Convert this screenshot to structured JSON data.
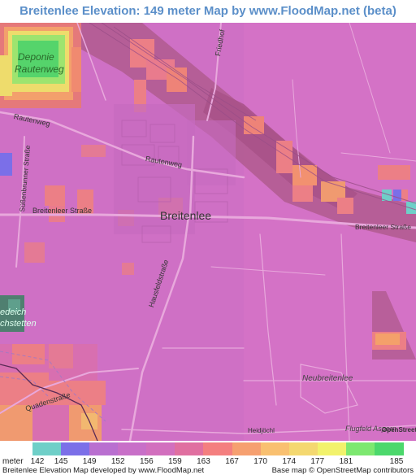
{
  "title": "Breitenlee Elevation: 149 meter Map by www.FloodMap.net (beta)",
  "map": {
    "labels": {
      "deponie": "Deponie",
      "rautenweg_deponie": "Rautenweg",
      "rautenweg_road1": "Rautenweg",
      "rautenweg_road2": "Rautenweg",
      "friedhof": "Friedhof",
      "breitenleer_strasse_w": "Breitenleer Straße",
      "breitenleer_strasse_e": "Breitenleer Straße",
      "breitenlee": "Breitenlee",
      "hausfeldstrasse": "Hausfeldstraße",
      "suessenbrunner": "Süßenbrunner Straße",
      "neubreitenlee": "Neubreitenlee",
      "quadenstrasse": "Quadenstraße",
      "heidjoechl": "Heidjöchl",
      "flugfeld": "Flugfeld Aspern",
      "edeich": "edeich",
      "chstetten": "chstetten",
      "osm_logo": "OpenStreetMap"
    }
  },
  "legend": {
    "unit_label": "meter",
    "values": [
      "142",
      "145",
      "149",
      "152",
      "156",
      "159",
      "163",
      "167",
      "170",
      "174",
      "177",
      "181",
      "185"
    ],
    "colors": [
      "#6fcfc8",
      "#7b6fe8",
      "#b96fd0",
      "#c86fc8",
      "#d26fbe",
      "#e06fa0",
      "#f47f7f",
      "#f6a070",
      "#f9c070",
      "#f4d870",
      "#f2f26c",
      "#7de870",
      "#4cd86c"
    ]
  },
  "footer": {
    "left": "Breitenlee Elevation Map developed by www.FloodMap.net",
    "right": "Base map © OpenStreetMap contributors"
  }
}
